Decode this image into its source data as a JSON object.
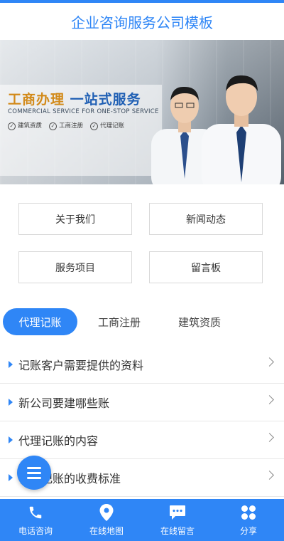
{
  "header": {
    "title": "企业咨询服务公司模板"
  },
  "banner": {
    "title_part1": "工商办理",
    "title_part2": "一站式服务",
    "subtitle": "COMMERCIAL SERVICE FOR ONE-STOP SERVICE",
    "tags": [
      "建筑资质",
      "工商注册",
      "代理记账"
    ]
  },
  "grid": {
    "about": "关于我们",
    "news": "新闻动态",
    "services": "服务项目",
    "guestbook": "留言板"
  },
  "tabs": [
    "代理记账",
    "工商注册",
    "建筑资质"
  ],
  "list": [
    "记账客户需要提供的资料",
    "新公司要建哪些账",
    "代理记账的内容",
    "代理记账的收费标准"
  ],
  "bottom_nav": {
    "phone": "电话咨询",
    "map": "在线地图",
    "message": "在线留言",
    "share": "分享"
  },
  "colors": {
    "accent": "#2f86f6",
    "banner_title_gold": "#d28a1a",
    "banner_title_blue": "#1f5fb4"
  }
}
